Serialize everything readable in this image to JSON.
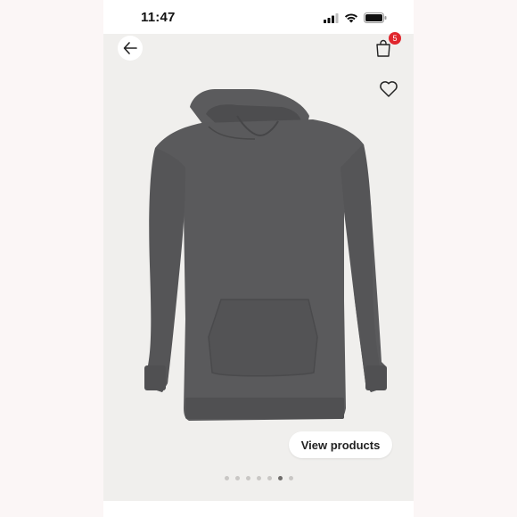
{
  "status_bar": {
    "time": "11:47"
  },
  "header": {
    "back_icon": "arrow-left-icon",
    "bag_icon": "shopping-bag-icon",
    "bag_count": "5",
    "favorite_icon": "heart-outline-icon"
  },
  "product": {
    "image_icon": "hoodie-dress-image",
    "color": "#5a5a5c"
  },
  "actions": {
    "view_products_label": "View products"
  },
  "carousel": {
    "dots": [
      {
        "active": false
      },
      {
        "active": false
      },
      {
        "active": false
      },
      {
        "active": false
      },
      {
        "active": false
      },
      {
        "active": true
      },
      {
        "active": false
      }
    ]
  },
  "colors": {
    "badge": "#e0262d",
    "background": "#f0efed"
  }
}
